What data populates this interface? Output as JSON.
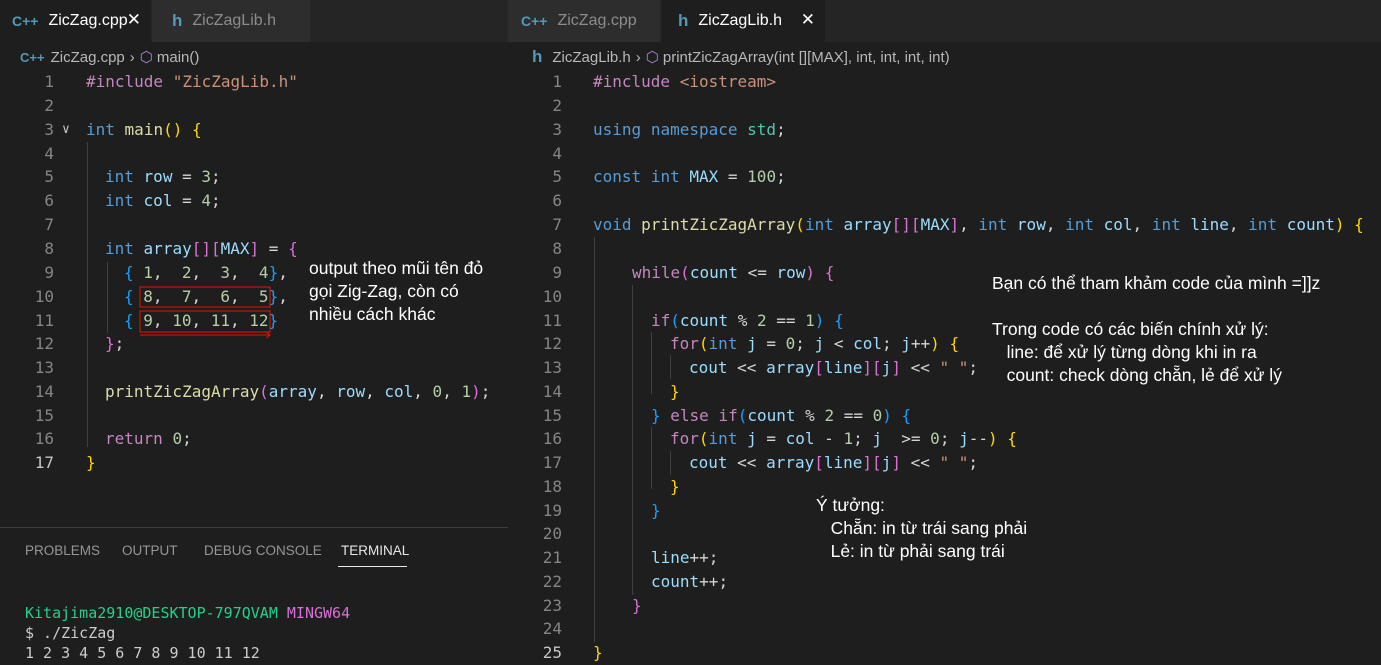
{
  "left_editor": {
    "tabs": [
      {
        "label": "ZicZag.cpp",
        "icon": "cpp-file-icon",
        "active": true
      },
      {
        "label": "ZicZagLib.h",
        "icon": "header-file-icon",
        "active": false
      }
    ],
    "breadcrumb": {
      "file": "ZicZag.cpp",
      "symbol": "main()"
    },
    "line_numbers": [
      "1",
      "2",
      "3",
      "4",
      "5",
      "6",
      "7",
      "8",
      "9",
      "10",
      "11",
      "12",
      "13",
      "14",
      "15",
      "16",
      "17"
    ],
    "lines": [
      "#include \"ZicZagLib.h\"",
      "",
      "int main() {",
      "",
      "int row = 3;",
      "int col = 4;",
      "",
      "int array[][MAX] = {",
      "{ 1,  2,  3,  4},",
      "{ 8,  7,  6,  5},",
      "{ 9, 10, 11, 12}",
      "};",
      "",
      "printZicZagArray(array, row, col, 0, 1);",
      "",
      "return 0;",
      "}"
    ],
    "annotation": "output theo mũi tên đỏ\ngọi Zig-Zag, còn có\nnhiều cách khác"
  },
  "right_editor": {
    "tabs": [
      {
        "label": "ZicZag.cpp",
        "icon": "cpp-file-icon",
        "active": false
      },
      {
        "label": "ZicZagLib.h",
        "icon": "header-file-icon",
        "active": true
      }
    ],
    "breadcrumb": {
      "file": "ZicZagLib.h",
      "symbol": "printZicZagArray(int [][MAX], int, int, int, int)"
    },
    "line_numbers": [
      "1",
      "2",
      "3",
      "4",
      "5",
      "6",
      "7",
      "8",
      "9",
      "10",
      "11",
      "12",
      "13",
      "14",
      "15",
      "16",
      "17",
      "18",
      "19",
      "20",
      "21",
      "22",
      "23",
      "24",
      "25"
    ],
    "lines": [
      "#include <iostream>",
      "",
      "using namespace std;",
      "",
      "const int MAX = 100;",
      "",
      "void printZicZagArray(int array[][MAX], int row, int col, int line, int count) {",
      "",
      "while(count <= row) {",
      "",
      "if(count % 2 == 1) {",
      "for(int j = 0; j < col; j++) {",
      "cout << array[line][j] << \" \";",
      "}",
      "} else if(count % 2 == 0) {",
      "for(int j = col - 1; j  >= 0; j--) {",
      "cout << array[line][j] << \" \";",
      "}",
      "}",
      "",
      "line++;",
      "count++;",
      "}",
      "",
      "}"
    ],
    "annotation_tip": "Bạn có thể tham khảm code của mình =]]z",
    "annotation_vars": "Trong code có các biến chính xử lý:\n   line: để xử lý từng dòng khi in ra\n   count: check dòng chẵn, lẻ để xử lý",
    "annotation_idea": "Ý tưởng:\n   Chẵn: in từ trái sang phải\n   Lẻ: in từ phải sang trái"
  },
  "panel": {
    "tabs": [
      "PROBLEMS",
      "OUTPUT",
      "DEBUG CONSOLE",
      "TERMINAL"
    ],
    "active_tab": "TERMINAL",
    "terminal": {
      "user_host": "Kitajima2910@DESKTOP-797QVAM",
      "shell": "MINGW64",
      "command": "$ ./ZicZag",
      "output": "1 2 3 4 5 6 7 8 9 10 11 12"
    }
  },
  "colors": {
    "keyword": "#569cd6",
    "control": "#c586c0",
    "function": "#dcdcaa",
    "variable": "#9cdcfe",
    "string": "#ce9178",
    "number": "#b5cea8",
    "highlight_box": "#e51400",
    "terminal_user": "#23d18b",
    "terminal_shell": "#d670d6"
  }
}
